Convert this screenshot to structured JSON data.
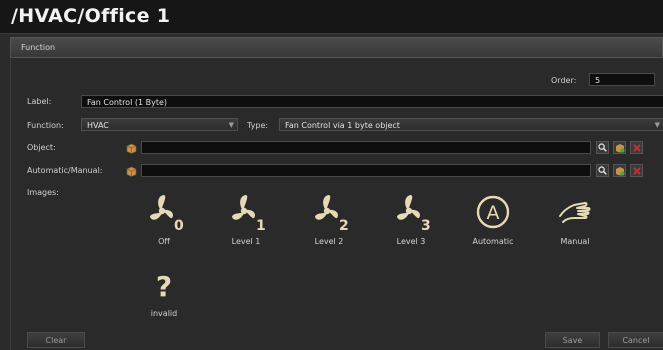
{
  "window": {
    "title": "/HVAC/Office 1"
  },
  "panel": {
    "heading": "Function"
  },
  "form": {
    "order_label": "Order:",
    "order_value": "5",
    "label_label": "Label:",
    "label_value": "Fan Control (1 Byte)",
    "function_label": "Function:",
    "function_value": "HVAC",
    "type_label": "Type:",
    "type_value": "Fan Control via 1 byte object",
    "object_label": "Object:",
    "object_value": "",
    "automanual_label": "Automatic/Manual:",
    "automanual_value": "",
    "images_label": "Images:"
  },
  "images": [
    {
      "caption": "Off",
      "icon": "fan-0-icon",
      "digit": "0"
    },
    {
      "caption": "Level 1",
      "icon": "fan-1-icon",
      "digit": "1"
    },
    {
      "caption": "Level 2",
      "icon": "fan-2-icon",
      "digit": "2"
    },
    {
      "caption": "Level 3",
      "icon": "fan-3-icon",
      "digit": "3"
    },
    {
      "caption": "Automatic",
      "icon": "automatic-icon",
      "glyph": "A"
    },
    {
      "caption": "Manual",
      "icon": "hand-icon"
    },
    {
      "caption": "invalid",
      "icon": "question-icon",
      "glyph": "?"
    }
  ],
  "buttons": {
    "clear": "Clear",
    "save": "Save",
    "cancel": "Cancel"
  },
  "colors": {
    "icon": "#e6d9b5",
    "background": "#2b2b2b",
    "field": "#0e0e0e"
  }
}
